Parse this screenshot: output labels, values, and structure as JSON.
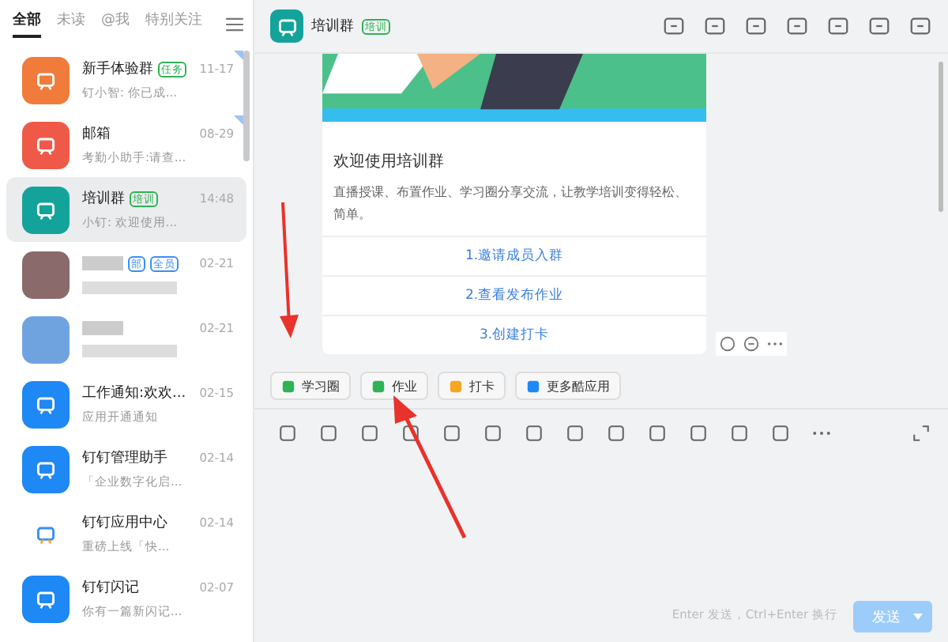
{
  "sidebar": {
    "tabs": [
      {
        "label": "全部",
        "selected": true
      },
      {
        "label": "未读",
        "selected": false
      },
      {
        "label": "@我",
        "selected": false
      },
      {
        "label": "特别关注",
        "selected": false
      }
    ],
    "chats": [
      {
        "kind": "normal",
        "name": "新手体验群",
        "tags": [
          {
            "text": "任务",
            "color": "#2fb355"
          }
        ],
        "time": "11-17",
        "preview": "钉小智: 你已成...",
        "color": "#f07b3a",
        "selected": false,
        "pinned": true
      },
      {
        "kind": "normal",
        "name": "邮箱",
        "time": "08-29",
        "preview": "考勤小助手:请查...",
        "color": "#ef5a48",
        "selected": false,
        "pinned": true
      },
      {
        "kind": "normal",
        "name": "培训群",
        "tags": [
          {
            "text": "培训",
            "color": "#2fb355"
          }
        ],
        "time": "14:48",
        "preview": "小钉: 欢迎使用...",
        "color": "#14a39a",
        "selected": true,
        "pinned": false
      },
      {
        "kind": "blurred",
        "tags": [
          {
            "text": "部",
            "color": "#3a8ef6"
          },
          {
            "text": "全员",
            "color": "#3a8ef6"
          }
        ],
        "time": "02-21",
        "color": "#8a6a6a",
        "selected": false,
        "pinned": false
      },
      {
        "kind": "blurred",
        "time": "02-21",
        "color": "#6fa3e0",
        "selected": false,
        "pinned": false
      },
      {
        "kind": "normal",
        "name": "工作通知:欢欢...",
        "time": "02-15",
        "preview": "应用开通通知",
        "color": "#1e88f5",
        "selected": false,
        "pinned": false
      },
      {
        "kind": "normal",
        "name": "钉钉管理助手",
        "time": "02-14",
        "preview": "「企业数字化启...",
        "color": "#1e88f5",
        "selected": false,
        "pinned": false
      },
      {
        "kind": "normal",
        "name": "钉钉应用中心",
        "time": "02-14",
        "preview": "重磅上线「快...",
        "color": "#ffffff",
        "selected": false,
        "pinned": false
      },
      {
        "kind": "normal",
        "name": "钉钉闪记",
        "time": "02-07",
        "preview": "你有一篇新闪记...",
        "color": "#1e88f5",
        "selected": false,
        "pinned": false
      }
    ]
  },
  "header": {
    "title": "培训群",
    "tag": "培训"
  },
  "card": {
    "title": "欢迎使用培训群",
    "text": "直播授课、布置作业、学习圈分享交流，让教学培训变得轻松、简单。",
    "links": [
      "1.邀请成员入群",
      "2.查看发布作业",
      "3.创建打卡"
    ]
  },
  "apps": [
    {
      "label": "学习圈",
      "color": "#2fb355"
    },
    {
      "label": "作业",
      "color": "#2fb355"
    },
    {
      "label": "打卡",
      "color": "#f5a623"
    },
    {
      "label": "更多酷应用",
      "color": "#1e88f5"
    }
  ],
  "input": {
    "hint": "Enter 发送，Ctrl+Enter 换行",
    "send": "发送",
    "disabled": true
  }
}
